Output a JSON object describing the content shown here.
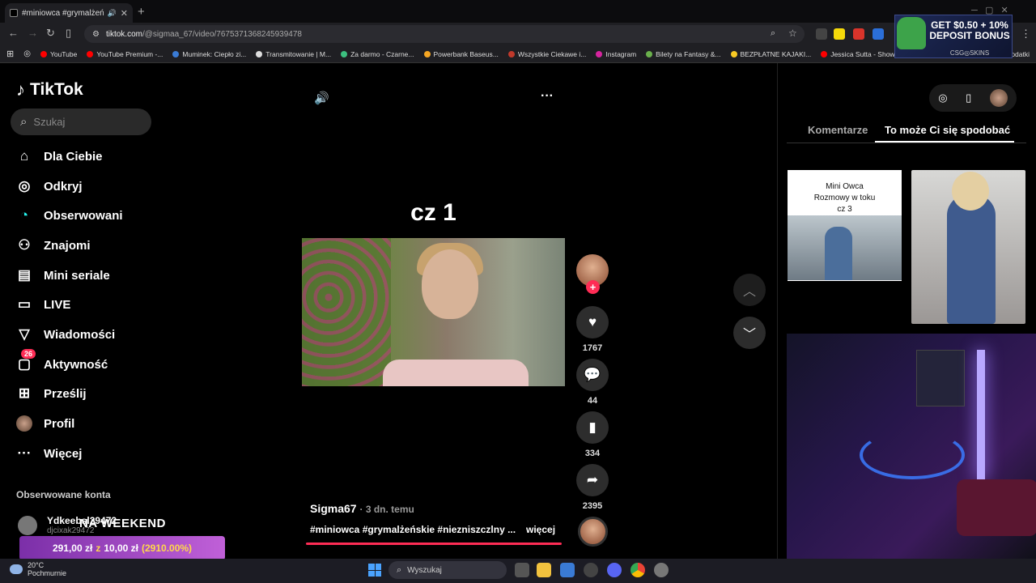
{
  "browser": {
    "tab_title": "#miniowca #grymalżeńskie",
    "url_host": "tiktok.com",
    "url_path": "/@sigmaa_67/video/7675371368245939478",
    "bookmarks": [
      {
        "label": "YouTube",
        "color": "#ff0000"
      },
      {
        "label": "YouTube Premium -...",
        "color": "#ff0000"
      },
      {
        "label": "Muminek: Ciepło zi...",
        "color": "#3a7bd5"
      },
      {
        "label": "Transmitowanie | M...",
        "color": "#dddddd"
      },
      {
        "label": "Za darmo - Czarne...",
        "color": "#3cbf7f"
      },
      {
        "label": "Powerbank Baseus...",
        "color": "#f5a623"
      },
      {
        "label": "Wszystkie Ciekawe i...",
        "color": "#c0392b"
      },
      {
        "label": "Instagram",
        "color": "#d6249f"
      },
      {
        "label": "Bilety na Fantasy &...",
        "color": "#6ab04c"
      },
      {
        "label": "BEZPŁATNE KAJAKI...",
        "color": "#f9ca24"
      },
      {
        "label": "Jessica Sutta - Show",
        "color": "#ff0000"
      }
    ],
    "bookmarks_overflow": "odatki"
  },
  "ad": {
    "line1": "GET $0.50 + 10%",
    "line2": "DEPOSIT BONUS",
    "brand": "CSG◎SKINS"
  },
  "sidebar": {
    "logo": "TikTok",
    "search_placeholder": "Szukaj",
    "items": [
      {
        "label": "Dla Ciebie",
        "icon": "⌂"
      },
      {
        "label": "Odkryj",
        "icon": "◎"
      },
      {
        "label": "Obserwowani",
        "icon": "◔"
      },
      {
        "label": "Znajomi",
        "icon": "⚇"
      },
      {
        "label": "Mini seriale",
        "icon": "▤"
      },
      {
        "label": "LIVE",
        "icon": "▭"
      },
      {
        "label": "Wiadomości",
        "icon": "▽"
      },
      {
        "label": "Aktywność",
        "icon": "▢"
      },
      {
        "label": "Prześlij",
        "icon": "⊞"
      },
      {
        "label": "Profil",
        "icon": "●"
      },
      {
        "label": "Więcej",
        "icon": "···"
      }
    ],
    "activity_badge": "26",
    "followed_heading": "Obserwowane konta",
    "account_name": "Ydkeebsl29472",
    "account_id": "djcixak29472"
  },
  "overlay": {
    "weekend": "NA WEEKEND",
    "promo_amount": "291,00 zł",
    "promo_z": "z",
    "promo_base": "10,00 zł",
    "promo_pct": "(2910.00%)"
  },
  "video": {
    "caption_overlay": "cz 1",
    "creator": "Sigma67",
    "age": "· 3 dn. temu",
    "hashtags": "#miniowca #grymalżeńskie #niezniszczlny ...",
    "more": "więcej",
    "likes": "1767",
    "comments": "44",
    "saves": "334",
    "shares": "2395"
  },
  "right_panel": {
    "tab_comments": "Komentarze",
    "tab_suggestions": "To może Ci się spodobać",
    "thumb1_caption_1": "Mini Owca",
    "thumb1_caption_2": "Rozmowy w toku",
    "thumb1_caption_3": "cz 3"
  },
  "taskbar": {
    "temp": "20°C",
    "weather": "Pochmurnie",
    "search_placeholder": "Wyszukaj"
  }
}
